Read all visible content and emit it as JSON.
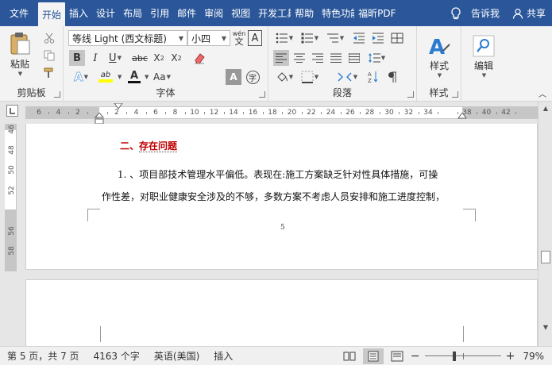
{
  "tabs": [
    {
      "label": "文件",
      "cls": "file"
    },
    {
      "label": "开始",
      "cls": "active"
    },
    {
      "label": "插入",
      "cls": ""
    },
    {
      "label": "设计",
      "cls": ""
    },
    {
      "label": "布局",
      "cls": ""
    },
    {
      "label": "引用",
      "cls": ""
    },
    {
      "label": "邮件",
      "cls": ""
    },
    {
      "label": "审阅",
      "cls": ""
    },
    {
      "label": "视图",
      "cls": ""
    },
    {
      "label": "开发工具",
      "cls": "narrow"
    },
    {
      "label": "帮助",
      "cls": ""
    },
    {
      "label": "特色功能",
      "cls": "narrow"
    },
    {
      "label": "福昕PDF",
      "cls": ""
    }
  ],
  "tell_me": "告诉我",
  "share": "共享",
  "ribbon": {
    "clipboard": {
      "paste": "粘贴",
      "label": "剪贴板"
    },
    "font": {
      "name": "等线 Light (西文标题)",
      "size": "小四",
      "phonetic": "wén",
      "phonetic_char": "文",
      "bold": "B",
      "italic": "I",
      "underline": "U",
      "strike": "abc",
      "subscript": "X",
      "subscript_mark": "2",
      "superscript": "X",
      "superscript_mark": "2",
      "text_effect": "A",
      "highlight": "ab",
      "font_color": "A",
      "change_case": "Aa",
      "char_shading": "A",
      "enclose": "字",
      "grow": "A",
      "shrink": "A",
      "border_char": "A",
      "label": "字体"
    },
    "paragraph": {
      "label": "段落"
    },
    "styles": {
      "button": "样式",
      "label": "样式"
    },
    "editing": {
      "button": "编辑"
    }
  },
  "ruler": {
    "ticks": [
      "6",
      "4",
      "2",
      "",
      "2",
      "4",
      "6",
      "8",
      "10",
      "12",
      "14",
      "16",
      "18",
      "20",
      "22",
      "24",
      "26",
      "28",
      "30",
      "32",
      "34",
      "",
      "38",
      "40",
      "42"
    ],
    "vticks": [
      "46",
      "48",
      "50",
      "52",
      "",
      "56",
      "58"
    ]
  },
  "document": {
    "heading_prefix": "二、",
    "heading_text": "存在问题",
    "line1": "1. 、项目部技术管理水平偏低。表现在:施工方案缺乏针对性具体措施，可操",
    "line2": "作性差，对职业健康安全涉及的不够，多数方案不考虑人员安排和施工进度控制，",
    "page_number": "5"
  },
  "status": {
    "page": "第 5 页，共 7 页",
    "words": "4163 个字",
    "language": "英语(美国)",
    "mode": "插入",
    "zoom_minus": "−",
    "zoom_plus": "+",
    "zoom": "79%",
    "zoom_value": 79
  },
  "colors": {
    "accent": "#2b579a",
    "heading": "#c00000",
    "highlight": "#ffff00",
    "font_color": "#c00000"
  }
}
